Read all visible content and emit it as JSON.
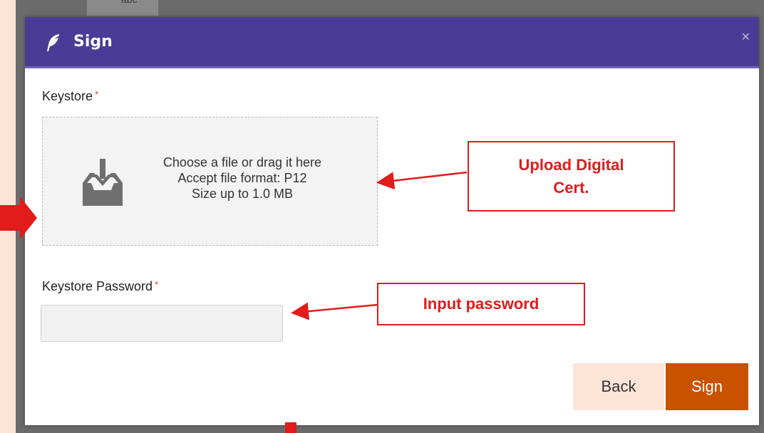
{
  "backdrop": {
    "tab_label": "abc"
  },
  "dialog": {
    "title": "Sign",
    "close_icon": "close-icon",
    "title_icon": "feather-icon"
  },
  "keystore": {
    "label": "Keystore",
    "required_mark": "*",
    "dropzone": {
      "icon": "upload-tray-icon",
      "line1": "Choose a file or drag it here",
      "line2": "Accept file format: P12",
      "line3": "Size up to 1.0 MB"
    }
  },
  "password": {
    "label": "Keystore Password",
    "required_mark": "*",
    "value": ""
  },
  "buttons": {
    "back": "Back",
    "sign": "Sign"
  },
  "annotations": {
    "upload_line1": "Upload Digital",
    "upload_line2": "Cert.",
    "password": "Input password",
    "color": "#e21b1b"
  },
  "colors": {
    "header": "#4a3c96",
    "sign_button": "#c85200",
    "back_button": "#fbe5d6",
    "page_background": "#fbe5d6"
  }
}
